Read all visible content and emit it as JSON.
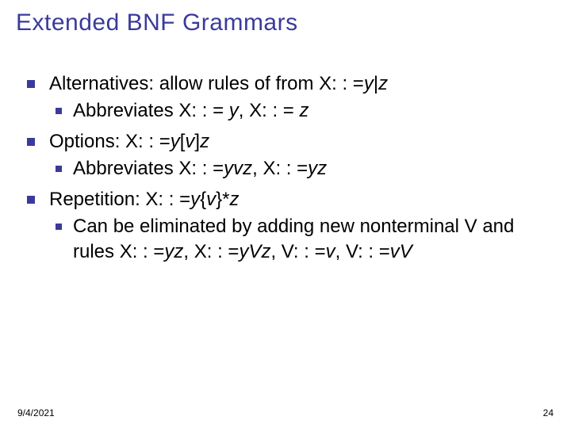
{
  "title": "Extended BNF Grammars",
  "bullets": {
    "b1": {
      "lead": "Alternatives: allow rules of from ",
      "rule_pre": "X: : =",
      "rule_y": "y",
      "rule_mid": "|",
      "rule_z": "z",
      "sub": {
        "lead": "Abbreviates  ",
        "r1_pre": "X: : = ",
        "r1_i": "y",
        "sep": ", ",
        "r2_pre": "X: : = ",
        "r2_i": "z"
      }
    },
    "b2": {
      "lead": "Options:  ",
      "r_pre": "X: : =",
      "r_y": "y",
      "r_lb": "[",
      "r_v": "v",
      "r_rb": "]",
      "r_z": "z",
      "sub": {
        "lead": "Abbreviates ",
        "r1_pre": "X: : =",
        "r1_i": "yvz",
        "sep": ", ",
        "r2_pre": "X: : =",
        "r2_i": "yz"
      }
    },
    "b3": {
      "lead": "Repetition: ",
      "r_pre": "X: : =",
      "r_y": "y",
      "r_lb": "{",
      "r_v": "v",
      "r_rb": "}*",
      "r_z": "z",
      "sub": {
        "lead": "Can be eliminated by adding new nonterminal ",
        "nt": "V",
        "mid": " and rules ",
        "r1_pre": "X: : =",
        "r1_i": "yz",
        "sep1": ", ",
        "r2_pre": "X: : =",
        "r2_i": "yVz",
        "sep2": ", ",
        "r3_pre": "V: : =",
        "r3_i": "v",
        "sep3": ", ",
        "r4_pre": "V: : =",
        "r4_i": "vV"
      }
    }
  },
  "footer": {
    "date": "9/4/2021",
    "pagenum": "24"
  }
}
